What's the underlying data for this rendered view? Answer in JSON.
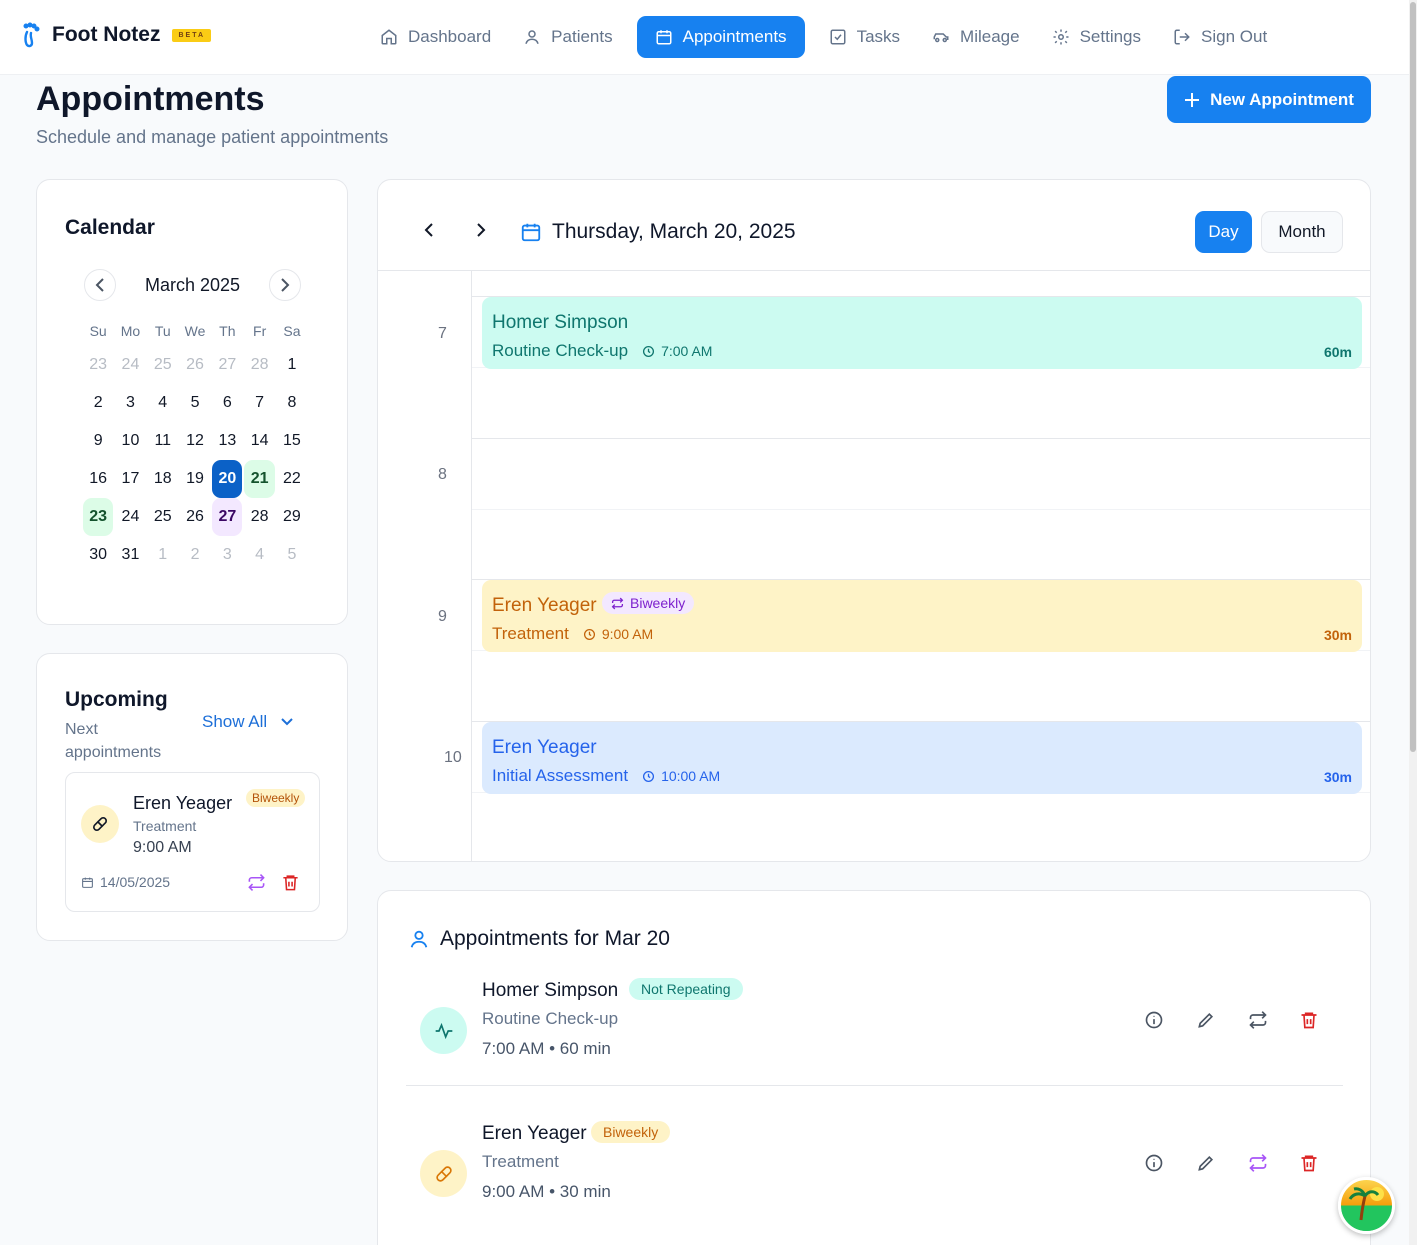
{
  "app": {
    "name": "Foot Notez",
    "beta": "BETA"
  },
  "nav": [
    {
      "label": "Dashboard",
      "icon": "home-icon",
      "active": false
    },
    {
      "label": "Patients",
      "icon": "user-icon",
      "active": false
    },
    {
      "label": "Appointments",
      "icon": "calendar-icon",
      "active": true
    },
    {
      "label": "Tasks",
      "icon": "checkbox-icon",
      "active": false
    },
    {
      "label": "Mileage",
      "icon": "car-icon",
      "active": false
    },
    {
      "label": "Settings",
      "icon": "gear-icon",
      "active": false
    },
    {
      "label": "Sign Out",
      "icon": "sign-out-icon",
      "active": false
    }
  ],
  "header": {
    "title": "Appointments",
    "subtitle": "Schedule and manage patient appointments",
    "new_button": "New Appointment"
  },
  "calendar": {
    "title": "Calendar",
    "month": "March 2025",
    "weekdays": [
      "Su",
      "Mo",
      "Tu",
      "We",
      "Th",
      "Fr",
      "Sa"
    ],
    "days": [
      [
        "23",
        "24",
        "25",
        "26",
        "27",
        "28",
        "1"
      ],
      [
        "2",
        "3",
        "4",
        "5",
        "6",
        "7",
        "8"
      ],
      [
        "9",
        "10",
        "11",
        "12",
        "13",
        "14",
        "15"
      ],
      [
        "16",
        "17",
        "18",
        "19",
        "20",
        "21",
        "22"
      ],
      [
        "23",
        "24",
        "25",
        "26",
        "27",
        "28",
        "29"
      ],
      [
        "30",
        "31",
        "1",
        "2",
        "3",
        "4",
        "5"
      ]
    ],
    "selected": "20"
  },
  "upcoming": {
    "title": "Upcoming",
    "subtitle": "Next appointments",
    "show_all": "Show All",
    "item": {
      "name": "Eren Yeager",
      "badge": "Biweekly",
      "type": "Treatment",
      "time": "9:00 AM",
      "date": "14/05/2025"
    }
  },
  "day_view": {
    "date": "Thursday, March 20, 2025",
    "view_day": "Day",
    "view_month": "Month",
    "hours": [
      "7",
      "8",
      "9",
      "10"
    ],
    "events": [
      {
        "name": "Homer Simpson",
        "type": "Routine Check-up",
        "time": "7:00 AM",
        "duration": "60m",
        "badge": ""
      },
      {
        "name": "Eren Yeager",
        "type": "Treatment",
        "time": "9:00 AM",
        "duration": "30m",
        "badge": "Biweekly"
      },
      {
        "name": "Eren Yeager",
        "type": "Initial Assessment",
        "time": "10:00 AM",
        "duration": "30m",
        "badge": ""
      }
    ]
  },
  "list": {
    "title": "Appointments for Mar 20",
    "items": [
      {
        "name": "Homer Simpson",
        "badge": "Not Repeating",
        "type": "Routine Check-up",
        "time": "7:00 AM  •  60 min"
      },
      {
        "name": "Eren Yeager",
        "badge": "Biweekly",
        "type": "Treatment",
        "time": "9:00 AM  •  30 min"
      }
    ]
  },
  "colors": {
    "primary": "#1781f0",
    "teal": "#ccfbf1",
    "amber": "#fef3c7",
    "blue": "#dbeafe",
    "danger": "#dc2626",
    "purple": "#a855f7"
  }
}
